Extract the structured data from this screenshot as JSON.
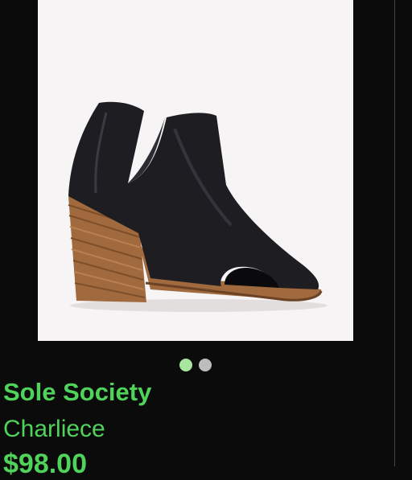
{
  "listing": {
    "brand": "Sole Society",
    "product_name": "Charliece",
    "price": "$98.00",
    "image_alt": "black leather open-toe ankle bootie with stacked wooden heel",
    "carousel": {
      "count": 2,
      "current": 1
    }
  },
  "colors": {
    "accent": "#4fd35a",
    "dot_active": "#a8e6a0",
    "dot_inactive": "#bdbdbd",
    "background": "#0b0b0b"
  }
}
